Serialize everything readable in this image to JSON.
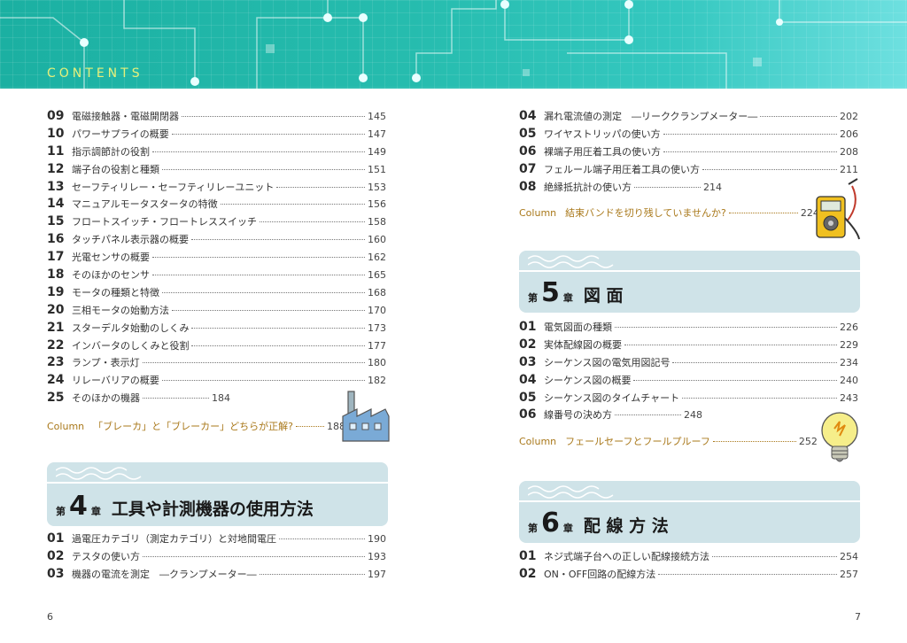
{
  "header": {
    "title": "CONTENTS"
  },
  "left": {
    "items": [
      {
        "num": "09",
        "title": "電磁接触器・電磁開閉器",
        "page": "145"
      },
      {
        "num": "10",
        "title": "パワーサプライの概要",
        "page": "147"
      },
      {
        "num": "11",
        "title": "指示調節計の役割",
        "page": "149"
      },
      {
        "num": "12",
        "title": "端子台の役割と種類",
        "page": "151"
      },
      {
        "num": "13",
        "title": "セーフティリレー・セーフティリレーユニット",
        "page": "153"
      },
      {
        "num": "14",
        "title": "マニュアルモータスタータの特徴",
        "page": "156"
      },
      {
        "num": "15",
        "title": "フロートスイッチ・フロートレススイッチ",
        "page": "158"
      },
      {
        "num": "16",
        "title": "タッチパネル表示器の概要",
        "page": "160"
      },
      {
        "num": "17",
        "title": "光電センサの概要",
        "page": "162"
      },
      {
        "num": "18",
        "title": "そのほかのセンサ",
        "page": "165"
      },
      {
        "num": "19",
        "title": "モータの種類と特徴",
        "page": "168"
      },
      {
        "num": "20",
        "title": "三相モータの始動方法",
        "page": "170"
      },
      {
        "num": "21",
        "title": "スターデルタ始動のしくみ",
        "page": "173"
      },
      {
        "num": "22",
        "title": "インバータのしくみと役割",
        "page": "177"
      },
      {
        "num": "23",
        "title": "ランプ・表示灯",
        "page": "180"
      },
      {
        "num": "24",
        "title": "リレーバリアの概要",
        "page": "182"
      },
      {
        "num": "25",
        "title": "そのほかの機器",
        "page": "184"
      }
    ],
    "column": {
      "label": "Column",
      "title": "「ブレーカ」と「ブレーカー」どちらが正解?",
      "page": "188"
    },
    "chapter4": {
      "dai": "第",
      "num": "4",
      "sho": "章",
      "title": "工具や計測機器の使用方法"
    },
    "items2": [
      {
        "num": "01",
        "title": "過電圧カテゴリ（測定カテゴリ）と対地間電圧",
        "page": "190"
      },
      {
        "num": "02",
        "title": "テスタの使い方",
        "page": "193"
      },
      {
        "num": "03",
        "title": "機器の電流を測定　―クランプメーター―",
        "page": "197"
      }
    ],
    "page_number": "6"
  },
  "right": {
    "items": [
      {
        "num": "04",
        "title": "漏れ電流値の測定　―リーククランプメーター―",
        "page": "202"
      },
      {
        "num": "05",
        "title": "ワイヤストリッパの使い方",
        "page": "206"
      },
      {
        "num": "06",
        "title": "裸端子用圧着工具の使い方",
        "page": "208"
      },
      {
        "num": "07",
        "title": "フェルール端子用圧着工具の使い方",
        "page": "211"
      },
      {
        "num": "08",
        "title": "絶縁抵抗計の使い方",
        "page": "214"
      }
    ],
    "column1": {
      "label": "Column",
      "title": "結束バンドを切り残していませんか?",
      "page": "224"
    },
    "chapter5": {
      "dai": "第",
      "num": "5",
      "sho": "章",
      "title": "図 面"
    },
    "items2": [
      {
        "num": "01",
        "title": "電気図面の種類",
        "page": "226"
      },
      {
        "num": "02",
        "title": "実体配線図の概要",
        "page": "229"
      },
      {
        "num": "03",
        "title": "シーケンス図の電気用図記号",
        "page": "234"
      },
      {
        "num": "04",
        "title": "シーケンス図の概要",
        "page": "240"
      },
      {
        "num": "05",
        "title": "シーケンス図のタイムチャート",
        "page": "243"
      },
      {
        "num": "06",
        "title": "線番号の決め方",
        "page": "248"
      }
    ],
    "column2": {
      "label": "Column",
      "title": "フェールセーフとフールプルーフ",
      "page": "252"
    },
    "chapter6": {
      "dai": "第",
      "num": "6",
      "sho": "章",
      "title": "配 線 方 法"
    },
    "items3": [
      {
        "num": "01",
        "title": "ネジ式端子台への正しい配線接続方法",
        "page": "254"
      },
      {
        "num": "02",
        "title": "ON・OFF回路の配線方法",
        "page": "257"
      }
    ],
    "page_number": "7"
  },
  "icons": [
    "factory-icon",
    "multimeter-icon",
    "light-bulb-icon"
  ],
  "colors": {
    "banner": "#26bcae",
    "chapter_bg": "#cfe3e8",
    "column_text": "#a9781a",
    "contents_text": "#e6f07a"
  }
}
